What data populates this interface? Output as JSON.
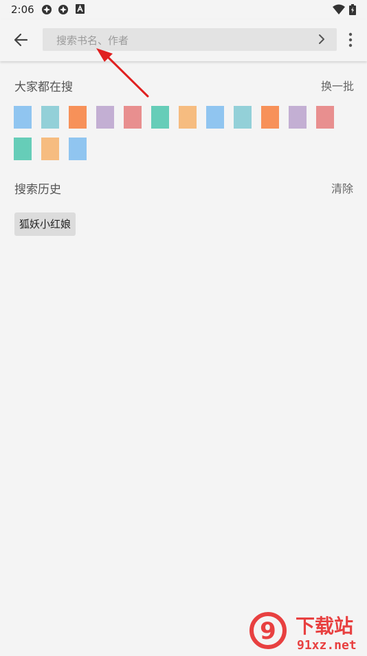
{
  "status_bar": {
    "time": "2:06",
    "icons": [
      "app-notification-icon",
      "app-notification-icon",
      "keyboard-a-icon",
      "wifi-icon",
      "battery-icon"
    ]
  },
  "app_bar": {
    "back_icon": "arrow-left-icon",
    "search_placeholder": "搜索书名、作者",
    "search_go_icon": "chevron-right-icon",
    "more_icon": "more-vertical-icon"
  },
  "popular": {
    "title": "大家都在搜",
    "refresh_label": "换一批",
    "tiles": [
      {
        "color": "#90c5f0"
      },
      {
        "color": "#93d0d8"
      },
      {
        "color": "#f79159"
      },
      {
        "color": "#c3afd3"
      },
      {
        "color": "#e88f8f"
      },
      {
        "color": "#66cdb8"
      },
      {
        "color": "#f6bc80"
      },
      {
        "color": "#90c5f0"
      },
      {
        "color": "#93d0d8"
      },
      {
        "color": "#f79159"
      },
      {
        "color": "#c3afd3"
      },
      {
        "color": "#e88f8f"
      },
      {
        "color": "#66cdb8"
      },
      {
        "color": "#f6bc80"
      },
      {
        "color": "#90c5f0"
      }
    ]
  },
  "history": {
    "title": "搜索历史",
    "clear_label": "清除",
    "items": [
      "狐妖小红娘"
    ]
  },
  "annotation": {
    "arrow_color": "#e02020"
  },
  "watermark": {
    "logo_text": "9",
    "title": "下载站",
    "url": "91xz.net",
    "color": "#e84040"
  }
}
